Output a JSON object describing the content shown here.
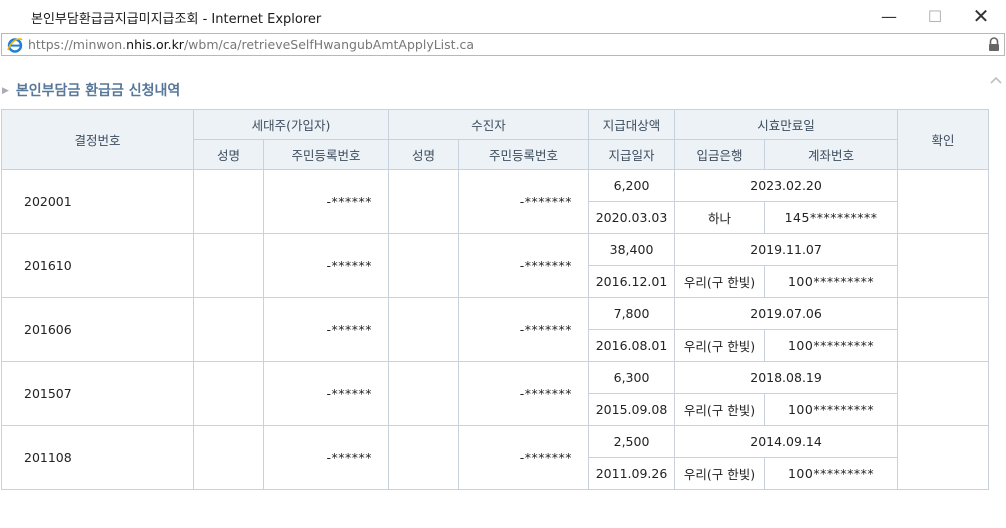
{
  "window": {
    "title": "본인부담환급금지급미지급조회 - Internet Explorer",
    "minimize": "—",
    "maximize": "☐",
    "close": "✕"
  },
  "address": {
    "prefix": "https://minwon.",
    "domain": "nhis.or.kr",
    "path": "/wbm/ca/retrieveSelfHwangubAmtApplyList.ca"
  },
  "section": {
    "arrow": "▶",
    "title": "본인부담금 환급금 신청내역"
  },
  "table": {
    "headers": {
      "decision": "결정번호",
      "householder": "세대주(가입자)",
      "recipient": "수진자",
      "amount": "지급대상액",
      "expiry": "시효만료일",
      "confirm": "확인",
      "name1": "성명",
      "rrn1": "주민등록번호",
      "name2": "성명",
      "rrn2": "주민등록번호",
      "paydate": "지급일자",
      "bank": "입금은행",
      "account": "계좌번호"
    },
    "rows": [
      {
        "decision": "202001",
        "hh_name": "",
        "hh_rrn": "-******",
        "rc_name": "",
        "rc_rrn": "-*******",
        "amount": "6,200",
        "expiry": "2023.02.20",
        "paydate": "2020.03.03",
        "bank": "하나",
        "account": "145**********",
        "confirm": ""
      },
      {
        "decision": "201610",
        "hh_name": "",
        "hh_rrn": "-******",
        "rc_name": "",
        "rc_rrn": "-*******",
        "amount": "38,400",
        "expiry": "2019.11.07",
        "paydate": "2016.12.01",
        "bank": "우리(구 한빛)",
        "account": "100*********",
        "confirm": ""
      },
      {
        "decision": "201606",
        "hh_name": "",
        "hh_rrn": "-******",
        "rc_name": "",
        "rc_rrn": "-*******",
        "amount": "7,800",
        "expiry": "2019.07.06",
        "paydate": "2016.08.01",
        "bank": "우리(구 한빛)",
        "account": "100*********",
        "confirm": ""
      },
      {
        "decision": "201507",
        "hh_name": "",
        "hh_rrn": "-******",
        "rc_name": "",
        "rc_rrn": "-*******",
        "amount": "6,300",
        "expiry": "2018.08.19",
        "paydate": "2015.09.08",
        "bank": "우리(구 한빛)",
        "account": "100*********",
        "confirm": ""
      },
      {
        "decision": "201108",
        "hh_name": "",
        "hh_rrn": "-******",
        "rc_name": "",
        "rc_rrn": "-*******",
        "amount": "2,500",
        "expiry": "2014.09.14",
        "paydate": "2011.09.26",
        "bank": "우리(구 한빛)",
        "account": "100*********",
        "confirm": ""
      }
    ]
  },
  "icons": {
    "browser": "ie-icon",
    "lock": "lock-icon",
    "scroll": "chevron-up-icon"
  }
}
